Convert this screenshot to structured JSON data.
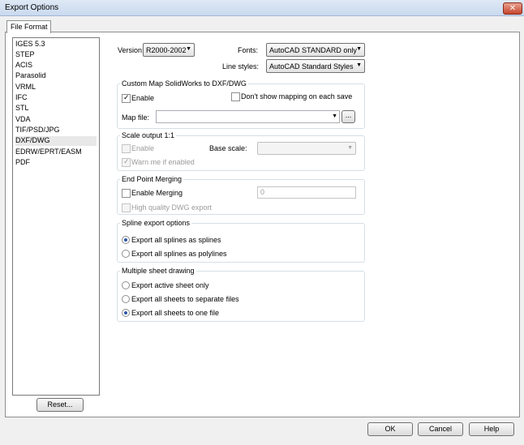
{
  "window": {
    "title": "Export Options",
    "close_glyph": "✕"
  },
  "tab": {
    "label": "File Format"
  },
  "formats": [
    "IGES 5.3",
    "STEP",
    "ACIS",
    "Parasolid",
    "VRML",
    "IFC",
    "STL",
    "VDA",
    "TIF/PSD/JPG",
    "DXF/DWG",
    "EDRW/EPRT/EASM",
    "PDF"
  ],
  "selected_format_index": 9,
  "top": {
    "version_label": "Version:",
    "version_value": "R2000-2002",
    "fonts_label": "Fonts:",
    "fonts_value": "AutoCAD STANDARD only",
    "linestyles_label": "Line styles:",
    "linestyles_value": "AutoCAD Standard Styles"
  },
  "custom_map": {
    "title": "Custom Map SolidWorks to DXF/DWG",
    "enable_label": "Enable",
    "enable_checked": true,
    "dont_show_label": "Don't show mapping on each save",
    "dont_show_checked": false,
    "map_file_label": "Map file:",
    "map_file_value": "",
    "browse_label": "..."
  },
  "scale": {
    "title": "Scale output 1:1",
    "enable_label": "Enable",
    "base_scale_label": "Base scale:",
    "warn_label": "Warn me if enabled",
    "warn_checked": true
  },
  "endpoint": {
    "title": "End Point Merging",
    "enable_label": "Enable Merging",
    "merge_value": "0",
    "hq_label": "High quality DWG export"
  },
  "spline": {
    "title": "Spline export options",
    "options": [
      "Export all splines as splines",
      "Export all splines as polylines"
    ],
    "selected": 0
  },
  "sheets": {
    "title": "Multiple sheet drawing",
    "options": [
      "Export active sheet only",
      "Export all sheets to separate files",
      "Export all sheets to one file"
    ],
    "selected": 2
  },
  "buttons": {
    "reset": "Reset...",
    "ok": "OK",
    "cancel": "Cancel",
    "help": "Help"
  },
  "icons": {
    "dropdown": "▼",
    "check": "✓"
  }
}
